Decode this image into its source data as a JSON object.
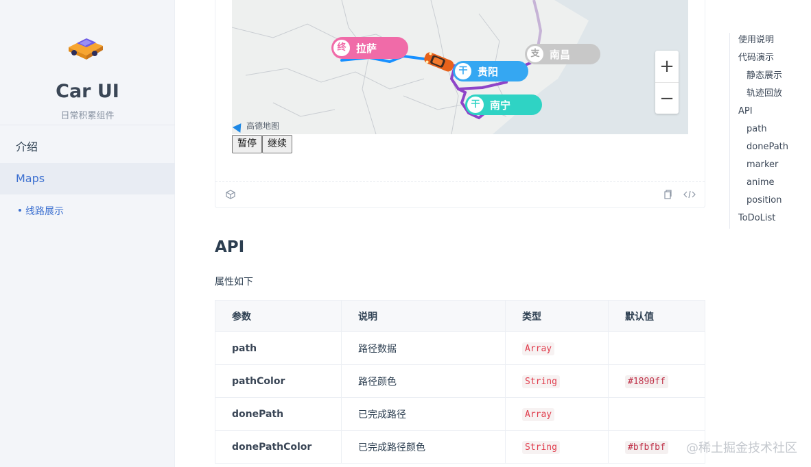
{
  "sidebar": {
    "brand_title": "Car UI",
    "brand_subtitle": "日常积累组件",
    "items": [
      {
        "label": "介绍"
      },
      {
        "label": "Maps"
      }
    ],
    "sub_items": [
      {
        "label": "线路展示"
      }
    ]
  },
  "demo": {
    "map_labels": {
      "lhasa": "拉萨",
      "lhasa_tag": "终",
      "guiyang": "贵阳",
      "guiyang_tag": "干",
      "nanning": "南宁",
      "nanning_tag": "干",
      "nanchang": "南昌",
      "nanchang_tag": "支"
    },
    "map_logo": "高德地图",
    "zoom_in": "+",
    "zoom_out": "−",
    "pause_label": "暂停",
    "resume_label": "继续"
  },
  "api": {
    "title": "API",
    "description": "属性如下",
    "columns": [
      "参数",
      "说明",
      "类型",
      "默认值"
    ],
    "rows": [
      {
        "name": "path",
        "desc": "路径数据",
        "type": "Array",
        "default": ""
      },
      {
        "name": "pathColor",
        "desc": "路径颜色",
        "type": "String",
        "default": "#1890ff"
      },
      {
        "name": "donePath",
        "desc": "已完成路径",
        "type": "Array",
        "default": ""
      },
      {
        "name": "donePathColor",
        "desc": "已完成路径颜色",
        "type": "String",
        "default": "#bfbfbf"
      }
    ]
  },
  "toc": {
    "items": [
      {
        "label": "使用说明",
        "level": 1
      },
      {
        "label": "代码演示",
        "level": 1
      },
      {
        "label": "静态展示",
        "level": 2
      },
      {
        "label": "轨迹回放",
        "level": 2
      },
      {
        "label": "API",
        "level": 1
      },
      {
        "label": "path",
        "level": 2
      },
      {
        "label": "donePath",
        "level": 2
      },
      {
        "label": "marker",
        "level": 2
      },
      {
        "label": "anime",
        "level": 2
      },
      {
        "label": "position",
        "level": 2
      },
      {
        "label": "ToDoList",
        "level": 1
      }
    ]
  },
  "watermark": "@稀土掘金技术社区",
  "colors": {
    "accent": "#3b6fd0",
    "path_blue": "#1890ff",
    "path_purple": "#8e44c8",
    "lhasa_pink": "#f06ba8",
    "guiyang_blue": "#35a7f2",
    "nanning_teal": "#2fd3c4",
    "nanchang_gray": "#c8c8c8"
  }
}
